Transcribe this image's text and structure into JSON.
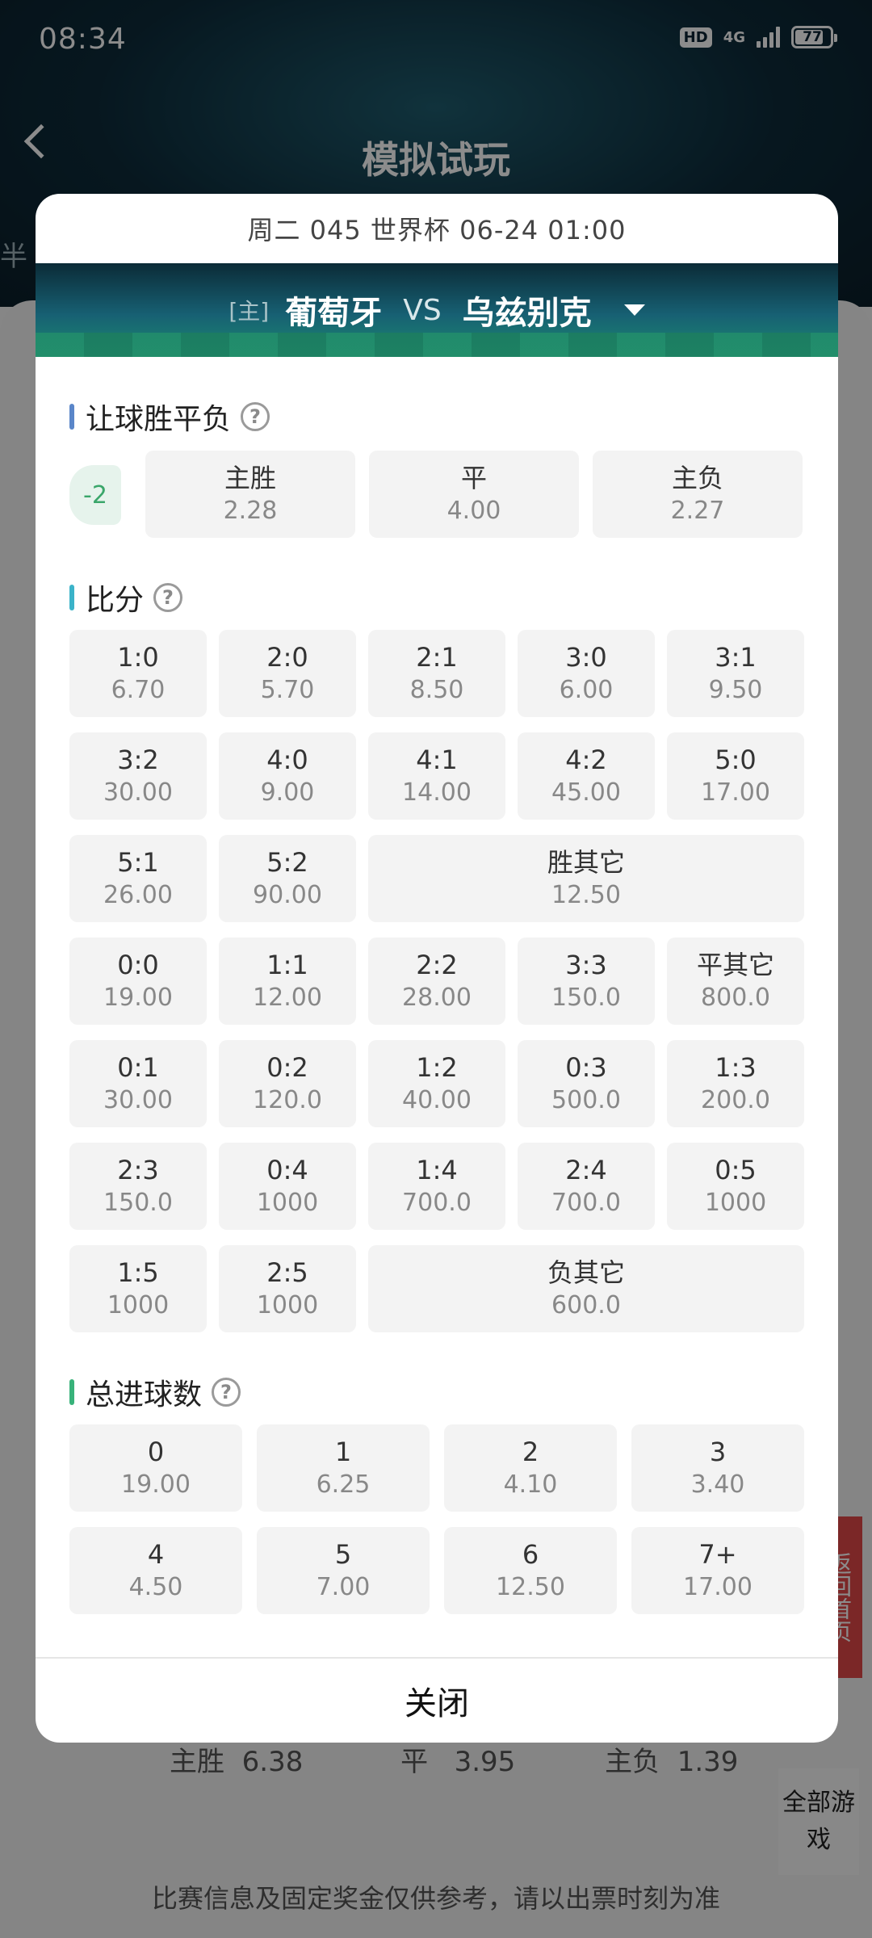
{
  "status_bar": {
    "time": "08:34",
    "hd": "HD",
    "network": "4G",
    "battery": "77"
  },
  "nav": {
    "title": "模拟试玩"
  },
  "background": {
    "left_fragment": "半",
    "row1": [
      "主胜",
      "6.38",
      "平",
      "3.95",
      "主负",
      "1.39"
    ],
    "side_tab": "全部游戏",
    "red_tab": "返回首页",
    "disclaimer": "比赛信息及固定奖金仅供参考，请以出票时刻为准"
  },
  "modal": {
    "header": "周二 045 世界杯 06-24 01:00",
    "home_tag": "[主]",
    "home_team": "葡萄牙",
    "vs": "VS",
    "away_team": "乌兹别克",
    "sections": {
      "handicap": {
        "title": "让球胜平负",
        "value": "-2",
        "options": [
          {
            "label": "主胜",
            "odds": "2.28"
          },
          {
            "label": "平",
            "odds": "4.00"
          },
          {
            "label": "主负",
            "odds": "2.27"
          }
        ]
      },
      "score": {
        "title": "比分",
        "rows": [
          [
            {
              "label": "1:0",
              "odds": "6.70"
            },
            {
              "label": "2:0",
              "odds": "5.70"
            },
            {
              "label": "2:1",
              "odds": "8.50"
            },
            {
              "label": "3:0",
              "odds": "6.00"
            },
            {
              "label": "3:1",
              "odds": "9.50"
            }
          ],
          [
            {
              "label": "3:2",
              "odds": "30.00"
            },
            {
              "label": "4:0",
              "odds": "9.00"
            },
            {
              "label": "4:1",
              "odds": "14.00"
            },
            {
              "label": "4:2",
              "odds": "45.00"
            },
            {
              "label": "5:0",
              "odds": "17.00"
            }
          ],
          [
            {
              "label": "5:1",
              "odds": "26.00"
            },
            {
              "label": "5:2",
              "odds": "90.00"
            },
            {
              "label": "胜其它",
              "odds": "12.50"
            }
          ],
          [
            {
              "label": "0:0",
              "odds": "19.00"
            },
            {
              "label": "1:1",
              "odds": "12.00"
            },
            {
              "label": "2:2",
              "odds": "28.00"
            },
            {
              "label": "3:3",
              "odds": "150.0"
            },
            {
              "label": "平其它",
              "odds": "800.0"
            }
          ],
          [
            {
              "label": "0:1",
              "odds": "30.00"
            },
            {
              "label": "0:2",
              "odds": "120.0"
            },
            {
              "label": "1:2",
              "odds": "40.00"
            },
            {
              "label": "0:3",
              "odds": "500.0"
            },
            {
              "label": "1:3",
              "odds": "200.0"
            }
          ],
          [
            {
              "label": "2:3",
              "odds": "150.0"
            },
            {
              "label": "0:4",
              "odds": "1000"
            },
            {
              "label": "1:4",
              "odds": "700.0"
            },
            {
              "label": "2:4",
              "odds": "700.0"
            },
            {
              "label": "0:5",
              "odds": "1000"
            }
          ],
          [
            {
              "label": "1:5",
              "odds": "1000"
            },
            {
              "label": "2:5",
              "odds": "1000"
            },
            {
              "label": "负其它",
              "odds": "600.0"
            }
          ]
        ]
      },
      "total_goals": {
        "title": "总进球数",
        "options": [
          {
            "label": "0",
            "odds": "19.00"
          },
          {
            "label": "1",
            "odds": "6.25"
          },
          {
            "label": "2",
            "odds": "4.10"
          },
          {
            "label": "3",
            "odds": "3.40"
          },
          {
            "label": "4",
            "odds": "4.50"
          },
          {
            "label": "5",
            "odds": "7.00"
          },
          {
            "label": "6",
            "odds": "12.50"
          },
          {
            "label": "7+",
            "odds": "17.00"
          }
        ]
      }
    },
    "help_symbol": "?",
    "close_label": "关闭"
  },
  "colors": {
    "handicap_bar": "#5a86c9",
    "score_bar": "#3bb3c9",
    "goals_bar": "#38b27a",
    "handicap_text": "#3aa66a"
  }
}
